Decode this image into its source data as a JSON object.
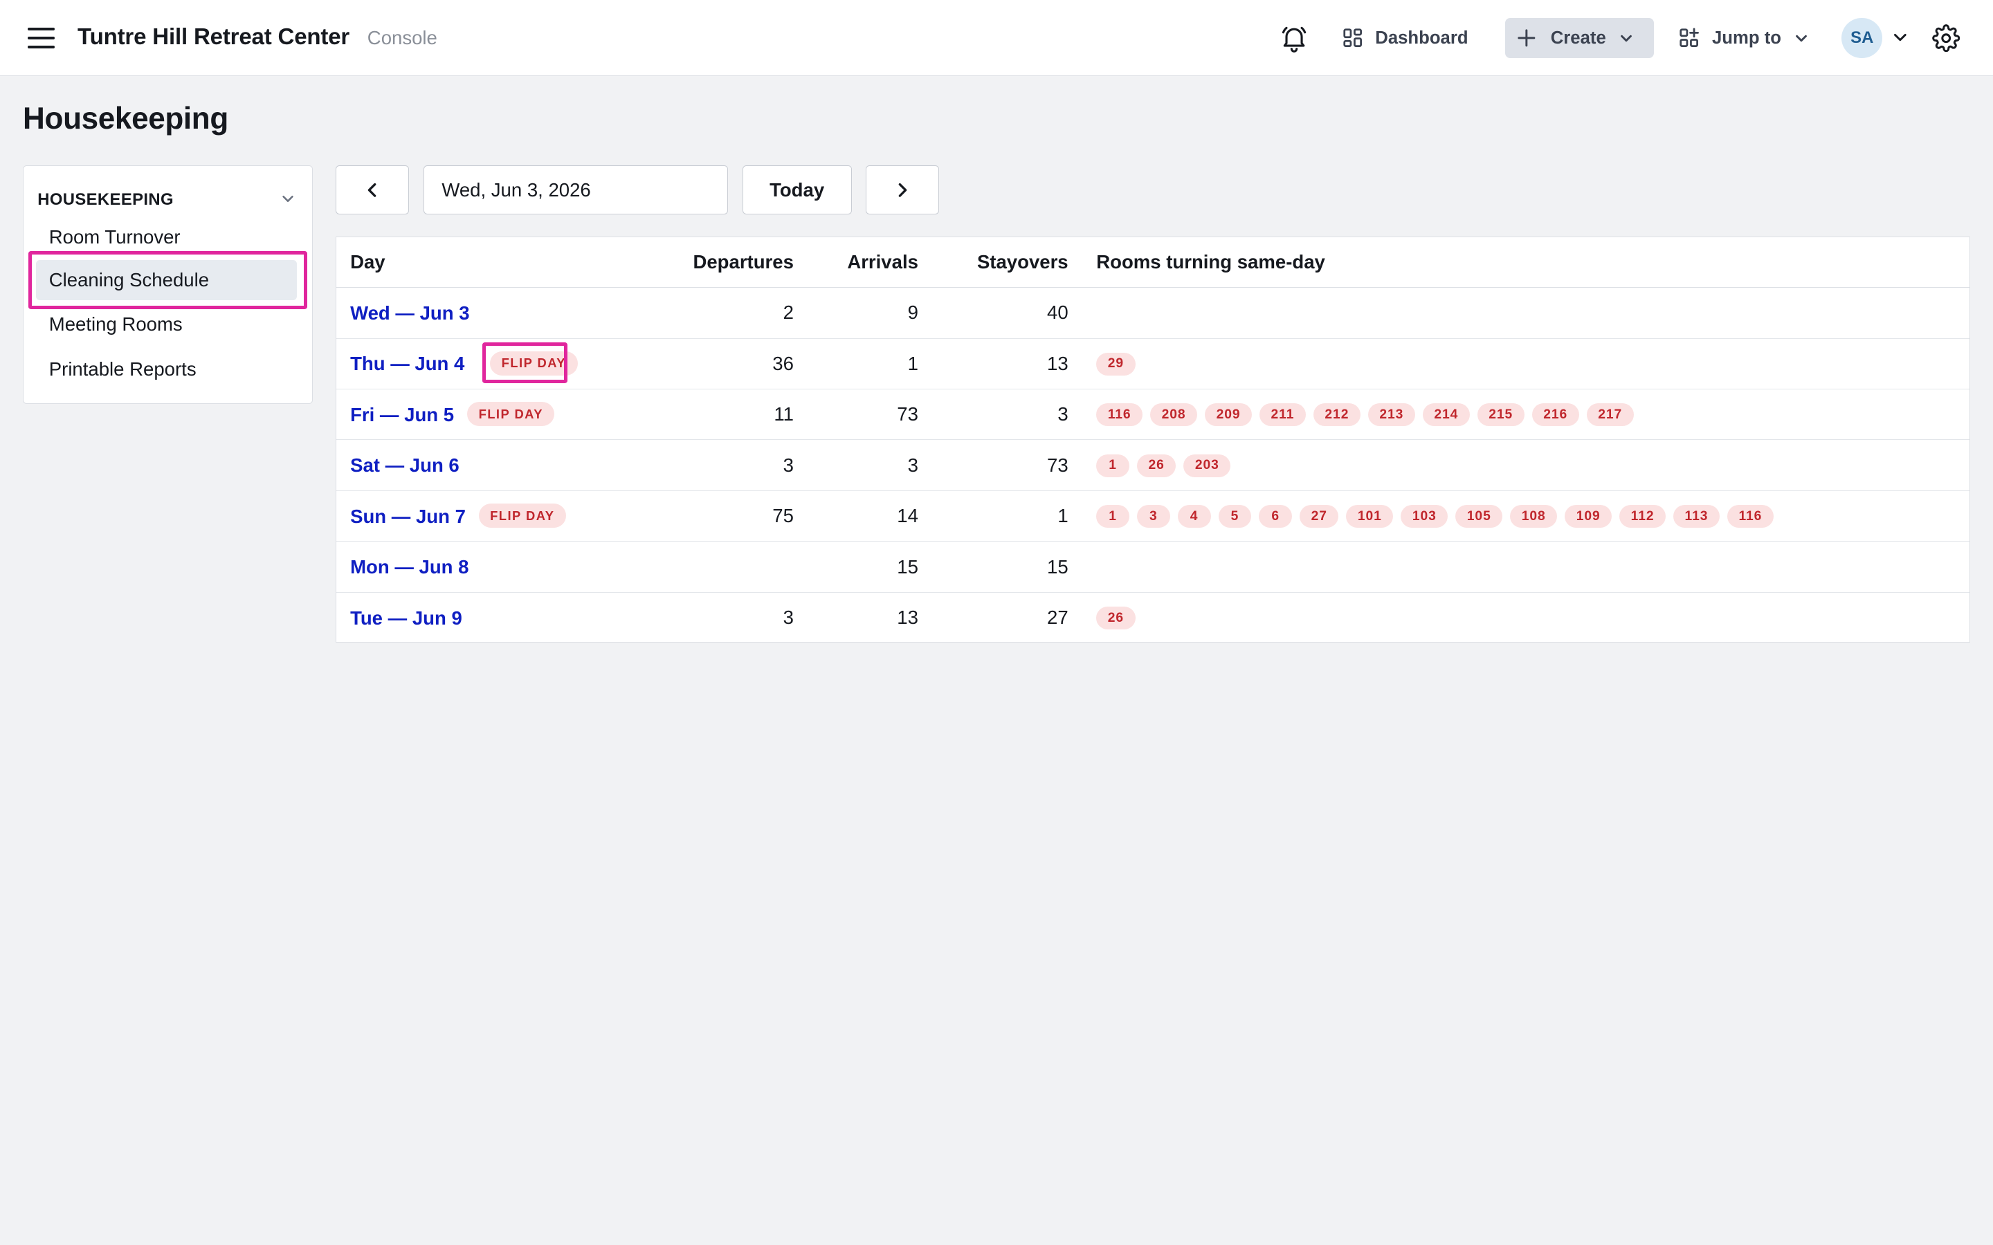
{
  "app": {
    "title": "Tuntre Hill Retreat Center",
    "subtitle": "Console"
  },
  "topnav": {
    "dashboard": "Dashboard",
    "create": "Create",
    "jump_to": "Jump to",
    "avatar_initials": "SA"
  },
  "page": {
    "title": "Housekeeping"
  },
  "sidebar": {
    "section_title": "HOUSEKEEPING",
    "items": [
      {
        "label": "Room Turnover",
        "active": false
      },
      {
        "label": "Cleaning Schedule",
        "active": true
      },
      {
        "label": "Meeting Rooms",
        "active": false
      },
      {
        "label": "Printable Reports",
        "active": false
      }
    ]
  },
  "date_controls": {
    "current_date": "Wed, Jun 3, 2026",
    "today_label": "Today"
  },
  "table": {
    "columns": {
      "day": "Day",
      "departures": "Departures",
      "arrivals": "Arrivals",
      "stayovers": "Stayovers",
      "rooms": "Rooms turning same-day"
    },
    "flip_label": "FLIP DAY",
    "rows": [
      {
        "day": "Wed — Jun 3",
        "flip": false,
        "departures": "2",
        "arrivals": "9",
        "stayovers": "40",
        "rooms": []
      },
      {
        "day": "Thu — Jun 4",
        "flip": true,
        "departures": "36",
        "arrivals": "1",
        "stayovers": "13",
        "rooms": [
          "29"
        ]
      },
      {
        "day": "Fri — Jun 5",
        "flip": true,
        "departures": "11",
        "arrivals": "73",
        "stayovers": "3",
        "rooms": [
          "116",
          "208",
          "209",
          "211",
          "212",
          "213",
          "214",
          "215",
          "216",
          "217"
        ]
      },
      {
        "day": "Sat — Jun 6",
        "flip": false,
        "departures": "3",
        "arrivals": "3",
        "stayovers": "73",
        "rooms": [
          "1",
          "26",
          "203"
        ]
      },
      {
        "day": "Sun — Jun 7",
        "flip": true,
        "departures": "75",
        "arrivals": "14",
        "stayovers": "1",
        "rooms": [
          "1",
          "3",
          "4",
          "5",
          "6",
          "27",
          "101",
          "103",
          "105",
          "108",
          "109",
          "112",
          "113",
          "116"
        ]
      },
      {
        "day": "Mon — Jun 8",
        "flip": false,
        "departures": "",
        "arrivals": "15",
        "stayovers": "15",
        "rooms": []
      },
      {
        "day": "Tue — Jun 9",
        "flip": false,
        "departures": "3",
        "arrivals": "13",
        "stayovers": "27",
        "rooms": [
          "26"
        ]
      }
    ]
  },
  "colors": {
    "link": "#0f1fc2",
    "flip_bg": "#fbe1e1",
    "flip_text": "#c0272d",
    "highlight": "#e0269d"
  }
}
